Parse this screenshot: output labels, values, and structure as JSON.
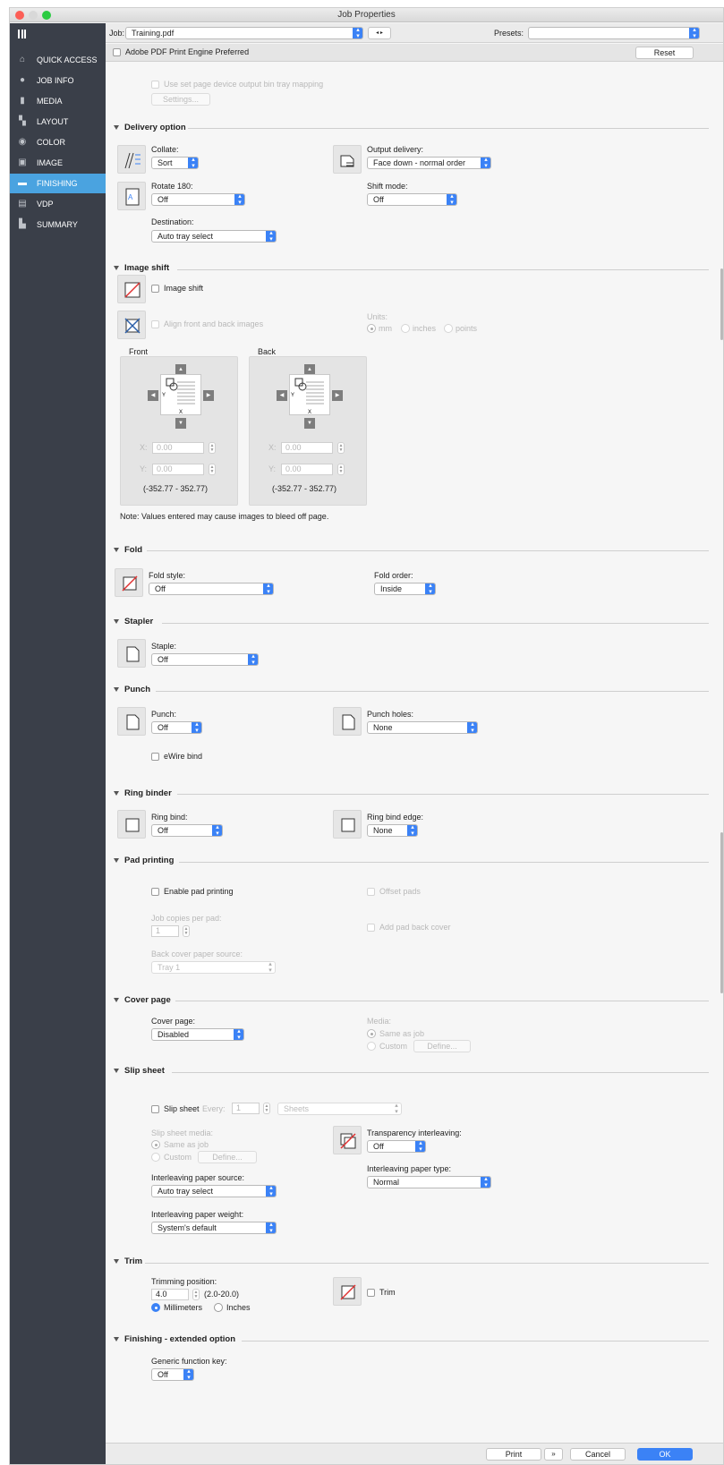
{
  "window_title": "Job Properties",
  "sidebar": {
    "items": [
      {
        "label": "QUICK ACCESS",
        "icon": "home-icon"
      },
      {
        "label": "JOB INFO",
        "icon": "info-icon"
      },
      {
        "label": "MEDIA",
        "icon": "media-icon"
      },
      {
        "label": "LAYOUT",
        "icon": "layout-icon"
      },
      {
        "label": "COLOR",
        "icon": "color-icon"
      },
      {
        "label": "IMAGE",
        "icon": "image-icon"
      },
      {
        "label": "FINISHING",
        "icon": "finishing-icon",
        "active": true
      },
      {
        "label": "VDP",
        "icon": "vdp-icon"
      },
      {
        "label": "SUMMARY",
        "icon": "summary-icon"
      }
    ]
  },
  "job_bar": {
    "job_label": "Job:",
    "job_value": "Training.pdf",
    "presets_label": "Presets:",
    "presets_value": ""
  },
  "option_bar": {
    "pdf_engine_label": "Adobe PDF Print Engine Preferred",
    "reset_label": "Reset"
  },
  "top": {
    "bin_mapping_label": "Use set page device output bin tray mapping",
    "settings_label": "Settings..."
  },
  "delivery": {
    "title": "Delivery option",
    "collate_label": "Collate:",
    "collate_value": "Sort",
    "rotate_label": "Rotate 180:",
    "rotate_value": "Off",
    "destination_label": "Destination:",
    "destination_value": "Auto tray select",
    "output_label": "Output delivery:",
    "output_value": "Face down - normal order",
    "shift_label": "Shift mode:",
    "shift_value": "Off"
  },
  "image_shift": {
    "title": "Image shift",
    "image_shift_label": "Image shift",
    "align_label": "Align front and back images",
    "units_label": "Units:",
    "unit_mm": "mm",
    "unit_inches": "inches",
    "unit_points": "points",
    "front_label": "Front",
    "back_label": "Back",
    "x_label": "X:",
    "y_label": "Y:",
    "front_x": "0.00",
    "front_y": "0.00",
    "back_x": "0.00",
    "back_y": "0.00",
    "front_range": "(-352.77 - 352.77)",
    "back_range": "(-352.77 - 352.77)",
    "note": "Note: Values entered may cause images to bleed off page."
  },
  "fold": {
    "title": "Fold",
    "style_label": "Fold style:",
    "style_value": "Off",
    "order_label": "Fold order:",
    "order_value": "Inside"
  },
  "stapler": {
    "title": "Stapler",
    "staple_label": "Staple:",
    "staple_value": "Off"
  },
  "punch": {
    "title": "Punch",
    "punch_label": "Punch:",
    "punch_value": "Off",
    "holes_label": "Punch holes:",
    "holes_value": "None",
    "ewire_label": "eWire bind"
  },
  "ring": {
    "title": "Ring binder",
    "bind_label": "Ring bind:",
    "bind_value": "Off",
    "edge_label": "Ring bind edge:",
    "edge_value": "None"
  },
  "pad": {
    "title": "Pad printing",
    "enable_label": "Enable pad printing",
    "offset_label": "Offset pads",
    "copies_label": "Job copies per pad:",
    "copies_value": "1",
    "back_cover_label": "Add pad back cover",
    "source_label": "Back cover paper source:",
    "source_value": "Tray 1"
  },
  "cover": {
    "title": "Cover page",
    "cover_label": "Cover page:",
    "cover_value": "Disabled",
    "media_label": "Media:",
    "same_as_job": "Same as job",
    "custom": "Custom",
    "define": "Define..."
  },
  "slip": {
    "title": "Slip sheet",
    "slip_label": "Slip sheet",
    "every_label": "Every:",
    "every_value": "1",
    "every_unit": "Sheets",
    "media_label": "Slip sheet media:",
    "same_as_job": "Same as job",
    "custom": "Custom",
    "define": "Define...",
    "transparency_label": "Transparency interleaving:",
    "transparency_value": "Off",
    "paper_type_label": "Interleaving paper type:",
    "paper_type_value": "Normal",
    "paper_source_label": "Interleaving paper source:",
    "paper_source_value": "Auto tray select",
    "paper_weight_label": "Interleaving paper weight:",
    "paper_weight_value": "System's default"
  },
  "trim": {
    "title": "Trim",
    "position_label": "Trimming position:",
    "position_value": "4.0",
    "range": "(2.0-20.0)",
    "mm_label": "Millimeters",
    "inches_label": "Inches",
    "trim_label": "Trim"
  },
  "extended": {
    "title": "Finishing - extended option",
    "key_label": "Generic function key:",
    "key_value": "Off"
  },
  "footer": {
    "print_label": "Print",
    "cancel_label": "Cancel",
    "ok_label": "OK"
  },
  "colors": {
    "accent": "#3b82f6",
    "sidebar": "#3a3f49",
    "active": "#4aa3e0"
  }
}
